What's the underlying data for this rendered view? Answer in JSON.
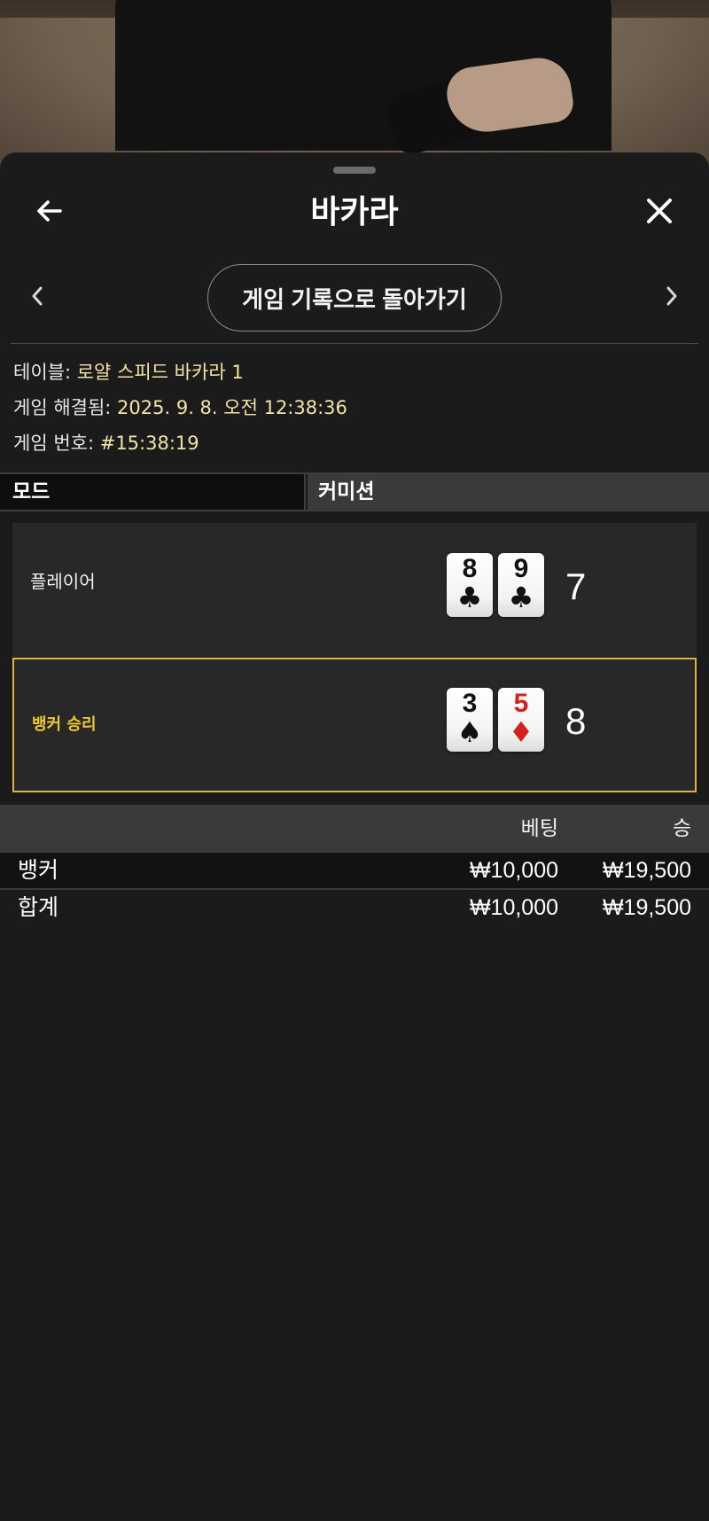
{
  "header": {
    "title": "바카라",
    "back_icon": "arrow-left-icon",
    "close_icon": "close-icon"
  },
  "nav": {
    "back_to_history_label": "게임 기록으로 돌아가기",
    "prev_icon": "chevron-left-icon",
    "next_icon": "chevron-right-icon"
  },
  "info": {
    "table_label": "테이블:",
    "table_value": "로얄 스피드 바카라 1",
    "resolved_label": "게임 해결됨:",
    "resolved_value": "2025. 9. 8. 오전 12:38:36",
    "number_label": "게임 번호:",
    "number_value": "#15:38:19"
  },
  "mode": {
    "label": "모드",
    "value": "커미션"
  },
  "hands": {
    "player": {
      "label": "플레이어",
      "cards": [
        {
          "rank": "8",
          "suit": "♣",
          "color": "black"
        },
        {
          "rank": "9",
          "suit": "♣",
          "color": "black"
        }
      ],
      "score": "7"
    },
    "banker": {
      "label": "뱅커 승리",
      "cards": [
        {
          "rank": "3",
          "suit": "♠",
          "color": "black"
        },
        {
          "rank": "5",
          "suit": "♦",
          "color": "red"
        }
      ],
      "score": "8"
    }
  },
  "bets": {
    "header_bet": "베팅",
    "header_win": "승",
    "rows": [
      {
        "name": "뱅커",
        "bet": "₩10,000",
        "win": "₩19,500"
      }
    ],
    "total": {
      "name": "합계",
      "bet": "₩10,000",
      "win": "₩19,500"
    }
  },
  "colors": {
    "accent_gold": "#d9b43c",
    "info_value": "#f3e3a6",
    "sheet_bg": "#1b1b1b"
  }
}
